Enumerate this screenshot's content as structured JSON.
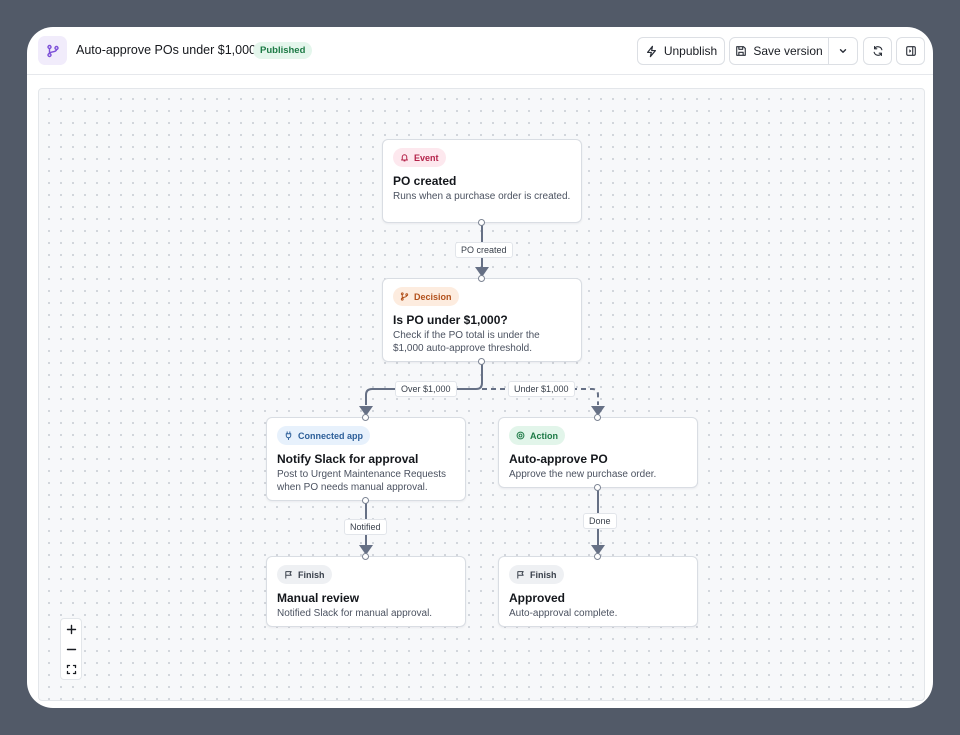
{
  "header": {
    "title": "Auto-approve POs under $1,000",
    "status_badge": "Published",
    "unpublish_label": "Unpublish",
    "save_version_label": "Save version",
    "icons": {
      "app": "workflow-branch-icon",
      "unpublish": "lightning-bolt-icon",
      "save": "floppy-disk-icon",
      "more": "chevron-down-icon",
      "refresh": "refresh-icon",
      "panel": "sidebar-panel-icon"
    }
  },
  "nodes": [
    {
      "id": "po-created",
      "tag": "Event",
      "tag_icon": "bell-icon",
      "title": "PO created",
      "desc": "Runs when a purchase order is created."
    },
    {
      "id": "decision",
      "tag": "Decision",
      "tag_icon": "branch-icon",
      "title": "Is PO under $1,000?",
      "desc": "Check if the PO total is under the $1,000 auto-approve threshold."
    },
    {
      "id": "notify-slack",
      "tag": "Connected app",
      "tag_icon": "plug-icon",
      "title": "Notify Slack for approval",
      "desc": "Post to Urgent Maintenance Requests when PO needs manual approval."
    },
    {
      "id": "auto-approve",
      "tag": "Action",
      "tag_icon": "target-icon",
      "title": "Auto-approve PO",
      "desc": "Approve the new purchase order."
    },
    {
      "id": "manual-review",
      "tag": "Finish",
      "tag_icon": "flag-icon",
      "title": "Manual review",
      "desc": "Notified Slack for manual approval."
    },
    {
      "id": "approved",
      "tag": "Finish",
      "tag_icon": "flag-icon",
      "title": "Approved",
      "desc": "Auto-approval complete."
    }
  ],
  "edges": [
    {
      "from": "po-created",
      "to": "decision",
      "label": "PO created",
      "style": "solid"
    },
    {
      "from": "decision",
      "to": "notify-slack",
      "label": "Over $1,000",
      "style": "solid"
    },
    {
      "from": "decision",
      "to": "auto-approve",
      "label": "Under $1,000",
      "style": "dashed"
    },
    {
      "from": "notify-slack",
      "to": "manual-review",
      "label": "Notified",
      "style": "solid"
    },
    {
      "from": "auto-approve",
      "to": "approved",
      "label": "Done",
      "style": "solid"
    }
  ],
  "zoom_controls": {
    "zoom_in": "plus-icon",
    "zoom_out": "minus-icon",
    "fit": "fit-view-icon"
  },
  "colors": {
    "backdrop": "#525a68",
    "edge": "#667085",
    "published": "#1c7a45",
    "event": "#b4234a",
    "decision": "#b2501b",
    "connected_app": "#2d5f99",
    "action": "#1d7a46"
  }
}
